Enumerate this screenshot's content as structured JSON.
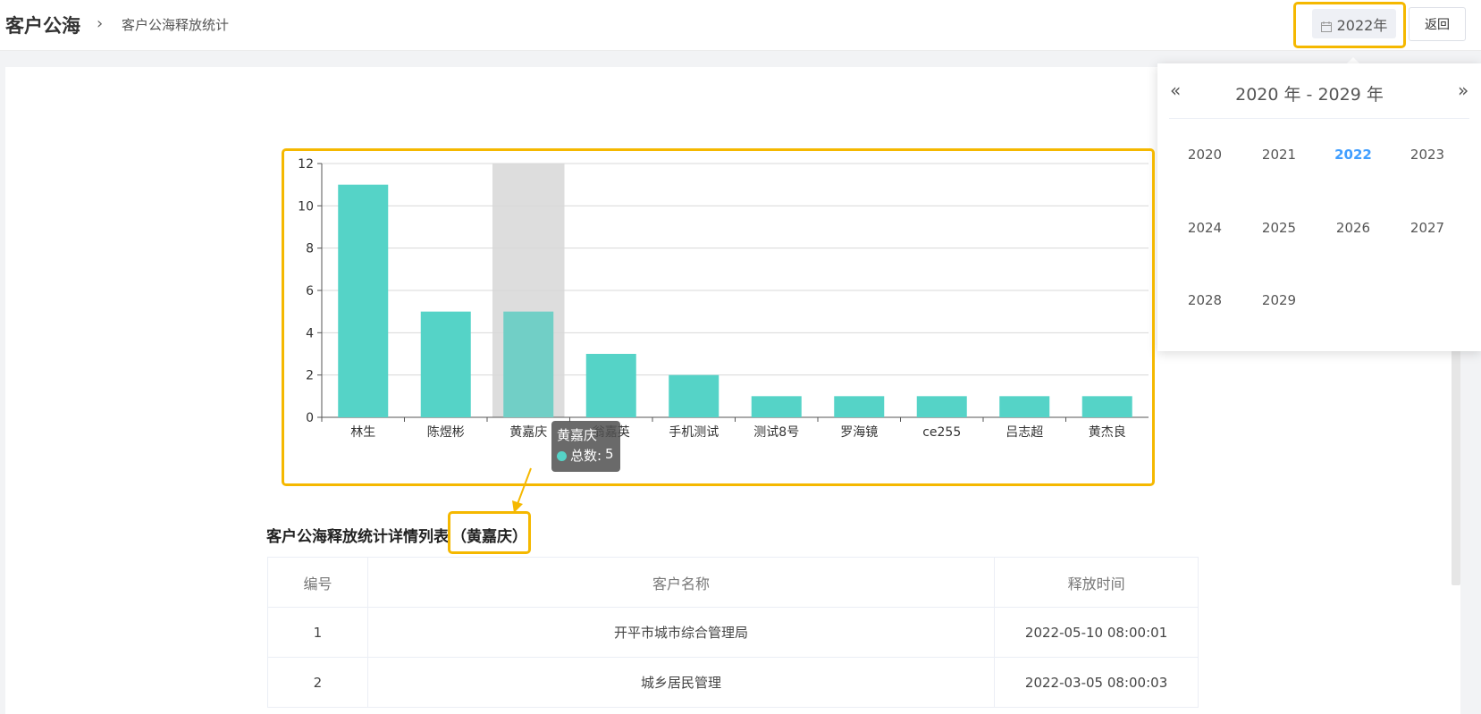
{
  "header": {
    "breadcrumb_root": "客户公海",
    "breadcrumb_sep": "›",
    "breadcrumb_current": "客户公海释放统计",
    "year_value": "2022年",
    "back_label": "返回"
  },
  "chart_data": {
    "type": "bar",
    "categories": [
      "林生",
      "陈煜彬",
      "黄嘉庆",
      "翁嘉英",
      "手机测试",
      "测试8号",
      "罗海镜",
      "ce255",
      "吕志超",
      "黄杰良"
    ],
    "series": [
      {
        "values": [
          11,
          5,
          5,
          3,
          2,
          1,
          1,
          1,
          1,
          1
        ]
      }
    ],
    "ylim": [
      0,
      12
    ],
    "yticks": [
      "0",
      "2",
      "4",
      "6",
      "8",
      "10",
      "12"
    ],
    "grid": true,
    "highlighted_category": "黄嘉庆",
    "colors": {
      "bar": "#55d3c7",
      "bar_hover": "#71cfc6",
      "hover_band": "#dddddd"
    }
  },
  "tooltip": {
    "title": "黄嘉庆",
    "label": "总数:",
    "value": "5"
  },
  "table": {
    "title": "客户公海释放统计详情列表",
    "title_name": "（黄嘉庆）",
    "columns": [
      "编号",
      "客户名称",
      "释放时间"
    ],
    "rows": [
      [
        "1",
        "开平市城市综合管理局",
        "2022-05-10 08:00:01"
      ],
      [
        "2",
        "城乡居民管理",
        "2022-03-05 08:00:03"
      ]
    ]
  },
  "year_picker": {
    "prev_icon": "«",
    "next_icon": "»",
    "range_label": "2020 年 - 2029 年",
    "years": [
      "2020",
      "2021",
      "2022",
      "2023",
      "2024",
      "2025",
      "2026",
      "2027",
      "2028",
      "2029"
    ],
    "selected": "2022"
  },
  "colors": {
    "highlight_border": "#f5b800",
    "selected_year": "#409eff"
  }
}
